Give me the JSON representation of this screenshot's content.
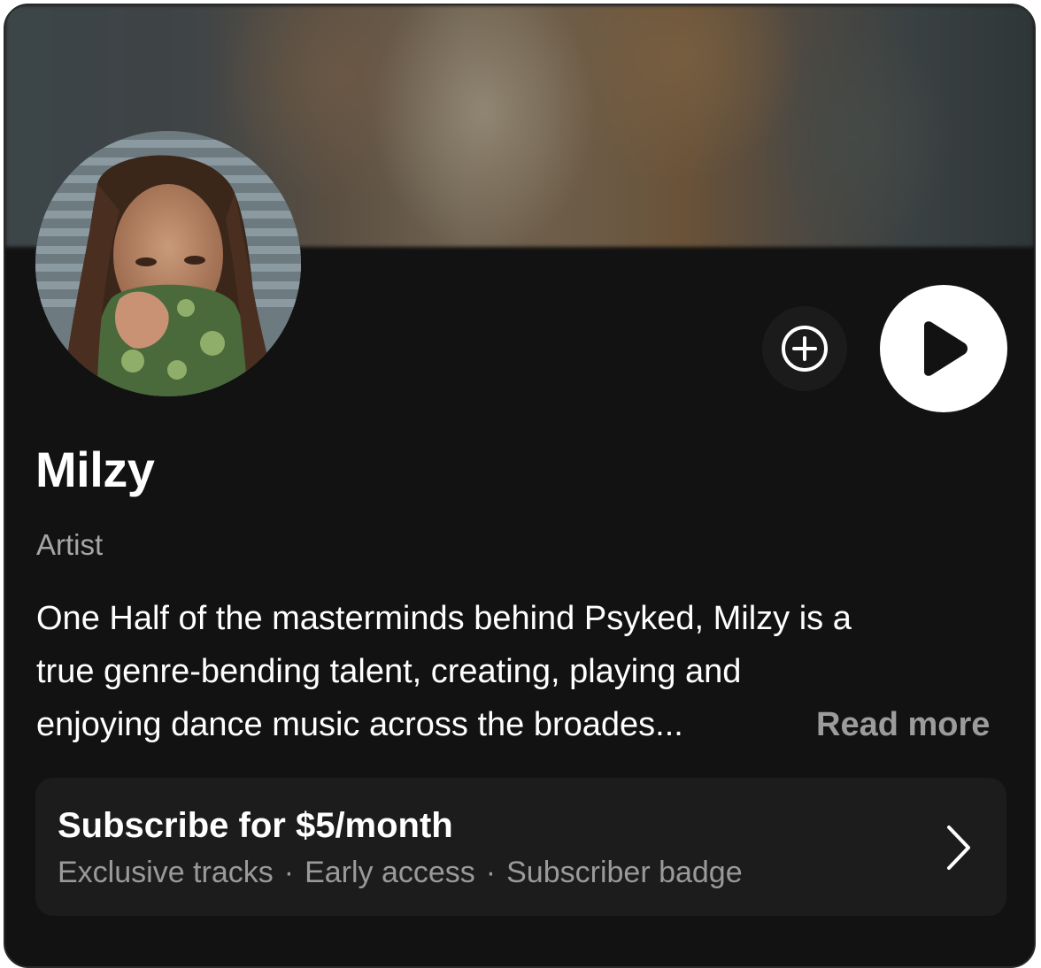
{
  "artist": {
    "name": "Milzy",
    "role": "Artist",
    "bio_lines": [
      "One Half of the masterminds behind Psyked, Milzy is a",
      "true genre-bending talent, creating, playing and",
      "enjoying dance music across the broades..."
    ],
    "read_more": "Read more"
  },
  "actions": {
    "add_icon": "plus-circle-icon",
    "play_icon": "play-icon"
  },
  "subscription": {
    "title": "Subscribe for $5/month",
    "perks": [
      "Exclusive tracks",
      "Early access",
      "Subscriber badge"
    ],
    "separator": "·",
    "chevron_icon": "chevron-right-icon"
  },
  "colors": {
    "background": "#121212",
    "text_primary": "#ffffff",
    "text_secondary": "#a6a6a6",
    "subscribe_bg": "#1c1c1c"
  }
}
